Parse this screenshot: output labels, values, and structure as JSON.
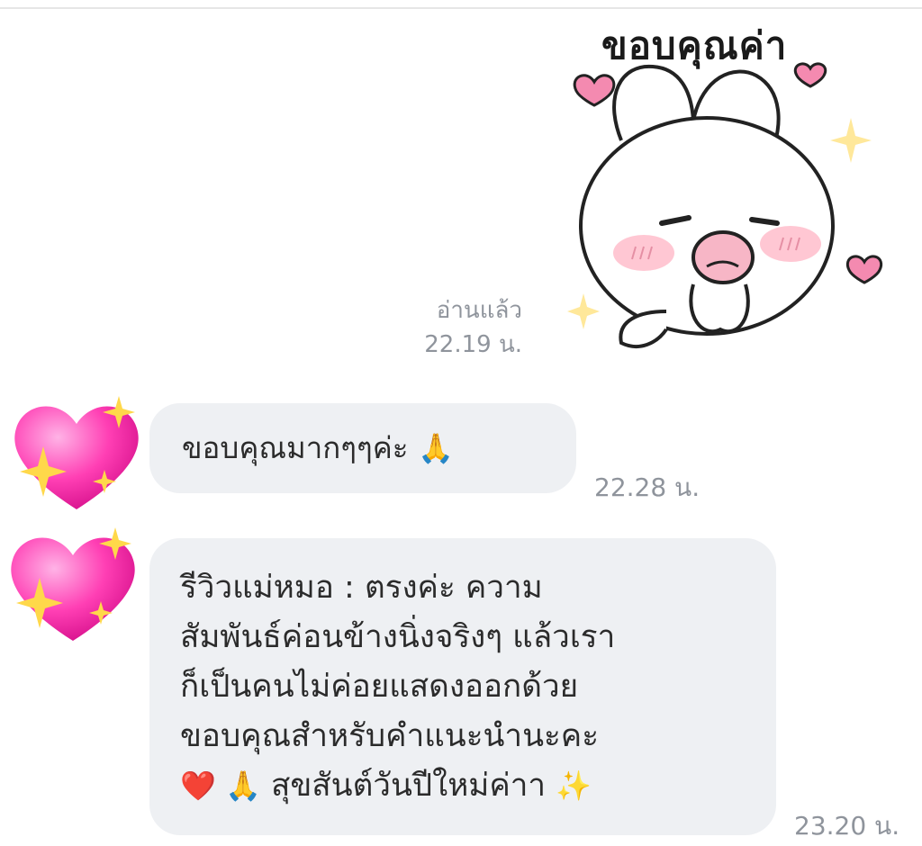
{
  "sticker": {
    "caption": "ขอบคุณค่า",
    "read_status": "อ่านแล้ว",
    "time": "22.19 น."
  },
  "messages": [
    {
      "text": "ขอบคุณมากๆๆค่ะ",
      "emoji": "🙏",
      "time": "22.28 น."
    },
    {
      "lines": [
        "รีวิวแม่หมอ : ตรงค่ะ ความ",
        "สัมพันธ์ค่อนข้างนิ่งจริงๆ แล้วเรา",
        "ก็เป็นคนไม่ค่อยแสดงออกด้วย",
        "ขอบคุณสำหรับคำแนะนำนะคะ"
      ],
      "last_line_prefix": "❤️ 🙏",
      "last_line_text": "สุขสันต์วันปีใหม่ค่าา",
      "last_line_suffix": "✨",
      "time": "23.20 น."
    }
  ],
  "avatar": {
    "icon": "sparkling-heart-icon",
    "color": "#ff3fb4"
  },
  "colors": {
    "bubble": "#eef0f3",
    "meta_text": "#8f949c"
  }
}
